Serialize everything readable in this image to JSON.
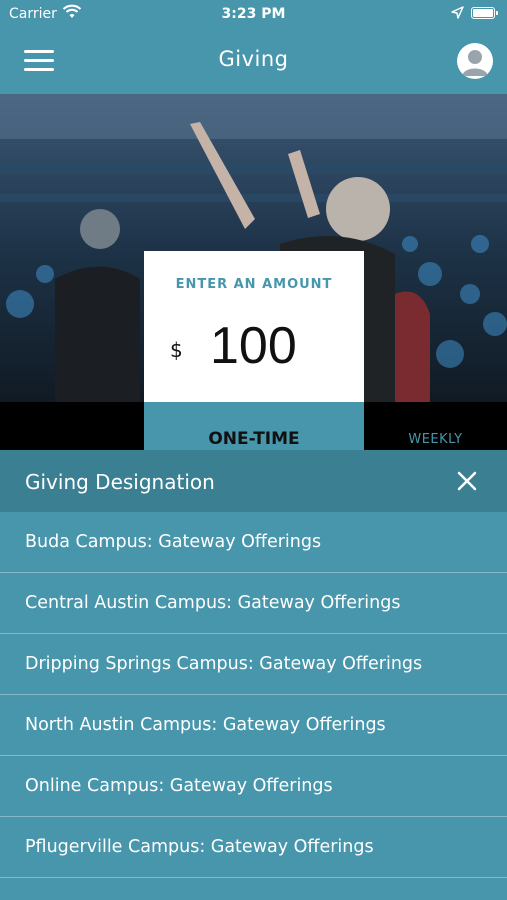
{
  "status_bar": {
    "carrier": "Carrier",
    "time": "3:23 PM"
  },
  "nav": {
    "title": "Giving",
    "menu_icon": "hamburger-menu-icon",
    "profile_icon": "user-avatar-icon"
  },
  "amount": {
    "label": "ENTER AN AMOUNT",
    "currency": "$",
    "value": "100"
  },
  "frequency": {
    "selected": "ONE-TIME",
    "other": "WEEKLY"
  },
  "designation": {
    "title": "Giving Designation",
    "close_icon": "close-icon",
    "items": [
      {
        "label": "Buda Campus: Gateway Offerings"
      },
      {
        "label": "Central Austin Campus: Gateway Offerings"
      },
      {
        "label": "Dripping Springs Campus: Gateway Offerings"
      },
      {
        "label": "North Austin Campus: Gateway Offerings"
      },
      {
        "label": "Online Campus: Gateway Offerings"
      },
      {
        "label": "Pflugerville Campus: Gateway Offerings"
      }
    ]
  },
  "colors": {
    "primary": "#4796ab",
    "header_dark": "#3a7f92",
    "strip": "#000000",
    "text": "#ffffff"
  }
}
